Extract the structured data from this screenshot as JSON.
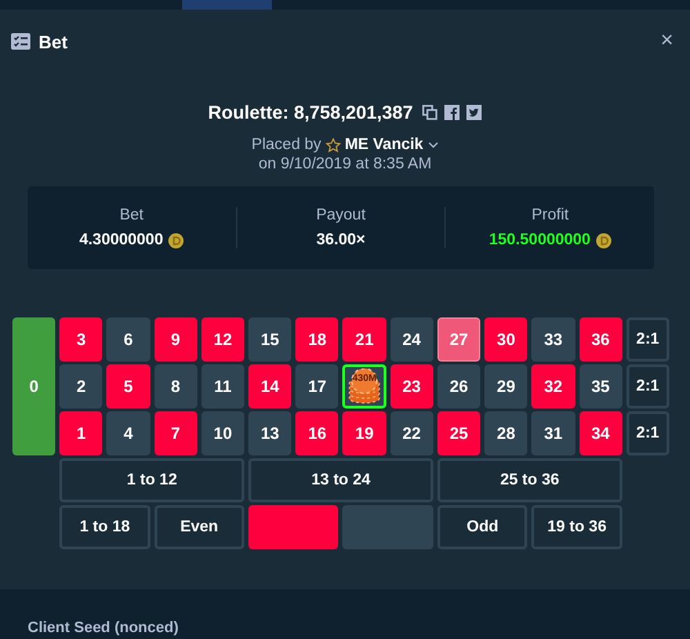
{
  "dialog": {
    "title": "Bet",
    "close": "×"
  },
  "bet_info": {
    "game": "Roulette: 8,758,201,387",
    "placed_by": "Placed by",
    "user": "ME Vancik",
    "date": "on 9/10/2019 at 8:35 AM"
  },
  "stats": [
    {
      "label": "Bet",
      "value": "4.30000000",
      "coin": true,
      "positive": false
    },
    {
      "label": "Payout",
      "value": "36.00×",
      "coin": false,
      "positive": false
    },
    {
      "label": "Profit",
      "value": "150.50000000",
      "coin": true,
      "positive": true
    }
  ],
  "board": {
    "zero": "0",
    "number_rows": [
      [
        {
          "label": "3",
          "color": "#ff003f",
          "winning": false,
          "has_bet": false
        },
        {
          "label": "6",
          "color": "#2f4553",
          "winning": false,
          "has_bet": false
        },
        {
          "label": "9",
          "color": "#ff003f",
          "winning": false,
          "has_bet": false
        },
        {
          "label": "12",
          "color": "#ff003f",
          "winning": false,
          "has_bet": false
        },
        {
          "label": "15",
          "color": "#2f4553",
          "winning": false,
          "has_bet": false
        },
        {
          "label": "18",
          "color": "#ff003f",
          "winning": false,
          "has_bet": false
        },
        {
          "label": "21",
          "color": "#ff003f",
          "winning": false,
          "has_bet": false
        },
        {
          "label": "24",
          "color": "#2f4553",
          "winning": false,
          "has_bet": false
        },
        {
          "label": "27",
          "color": "#f0587a",
          "winning": true,
          "has_bet": false
        },
        {
          "label": "30",
          "color": "#ff003f",
          "winning": false,
          "has_bet": false
        },
        {
          "label": "33",
          "color": "#2f4553",
          "winning": false,
          "has_bet": false
        },
        {
          "label": "36",
          "color": "#ff003f",
          "winning": false,
          "has_bet": false
        }
      ],
      [
        {
          "label": "2",
          "color": "#2f4553",
          "winning": false,
          "has_bet": false
        },
        {
          "label": "5",
          "color": "#ff003f",
          "winning": false,
          "has_bet": false
        },
        {
          "label": "8",
          "color": "#2f4553",
          "winning": false,
          "has_bet": false
        },
        {
          "label": "11",
          "color": "#2f4553",
          "winning": false,
          "has_bet": false
        },
        {
          "label": "14",
          "color": "#ff003f",
          "winning": false,
          "has_bet": false
        },
        {
          "label": "17",
          "color": "#2f4553",
          "winning": false,
          "has_bet": false
        },
        {
          "color": "#2f4553",
          "winning": false,
          "has_bet": true,
          "chip": "430M"
        },
        {
          "label": "23",
          "color": "#ff003f",
          "winning": false,
          "has_bet": false
        },
        {
          "label": "26",
          "color": "#2f4553",
          "winning": false,
          "has_bet": false
        },
        {
          "label": "29",
          "color": "#2f4553",
          "winning": false,
          "has_bet": false
        },
        {
          "label": "32",
          "color": "#ff003f",
          "winning": false,
          "has_bet": false
        },
        {
          "label": "35",
          "color": "#2f4553",
          "winning": false,
          "has_bet": false
        }
      ],
      [
        {
          "label": "1",
          "color": "#ff003f",
          "winning": false,
          "has_bet": false
        },
        {
          "label": "4",
          "color": "#2f4553",
          "winning": false,
          "has_bet": false
        },
        {
          "label": "7",
          "color": "#ff003f",
          "winning": false,
          "has_bet": false
        },
        {
          "label": "10",
          "color": "#2f4553",
          "winning": false,
          "has_bet": false
        },
        {
          "label": "13",
          "color": "#2f4553",
          "winning": false,
          "has_bet": false
        },
        {
          "label": "16",
          "color": "#ff003f",
          "winning": false,
          "has_bet": false
        },
        {
          "label": "19",
          "color": "#ff003f",
          "winning": false,
          "has_bet": false
        },
        {
          "label": "22",
          "color": "#2f4553",
          "winning": false,
          "has_bet": false
        },
        {
          "label": "25",
          "color": "#ff003f",
          "winning": false,
          "has_bet": false
        },
        {
          "label": "28",
          "color": "#2f4553",
          "winning": false,
          "has_bet": false
        },
        {
          "label": "31",
          "color": "#2f4553",
          "winning": false,
          "has_bet": false
        },
        {
          "label": "34",
          "color": "#ff003f",
          "winning": false,
          "has_bet": false
        }
      ]
    ],
    "column_bets": [
      "2:1",
      "2:1",
      "2:1"
    ],
    "dozens": [
      "1 to 12",
      "13 to 24",
      "25 to 36"
    ],
    "outside": [
      {
        "kind": "text",
        "label": "1 to 18"
      },
      {
        "kind": "text",
        "label": "Even"
      },
      {
        "kind": "color",
        "color": "#ff003f"
      },
      {
        "kind": "color",
        "color": "#2f4553"
      },
      {
        "kind": "text",
        "label": "Odd"
      },
      {
        "kind": "text",
        "label": "19 to 36"
      }
    ]
  },
  "seed_section": {
    "label": "Client Seed (nonced)"
  }
}
